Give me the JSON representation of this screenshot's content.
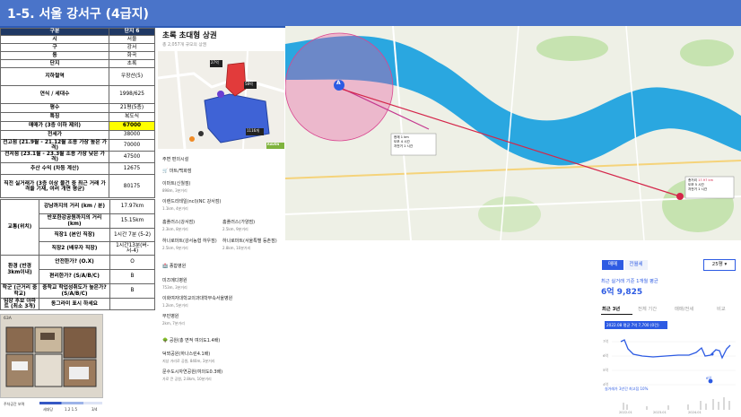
{
  "header": {
    "title": "1-5. 서울 강서구 (4급지)"
  },
  "spec_table": {
    "col_header": "구분",
    "col_value": "단지 6",
    "rows": [
      {
        "label": "시",
        "value": "서울"
      },
      {
        "label": "구",
        "value": "강서"
      },
      {
        "label": "동",
        "value": "화곡"
      },
      {
        "label": "단지",
        "value": "초록"
      },
      {
        "label": "지하철역",
        "value": "우장산(5)"
      },
      {
        "label": "연식 / 세대수",
        "value": "1998/625"
      },
      {
        "label": "평수",
        "value": "21평(5층)"
      },
      {
        "label": "특징",
        "value": "복도식"
      },
      {
        "label": "매매가 (3층 이하 제외)",
        "value": "67000"
      },
      {
        "label": "전세가",
        "value": "38000"
      },
      {
        "label": "전고점 (21.9월 - 21.12월 조용 가장 높은 가격)",
        "value": "70000"
      },
      {
        "label": "전저점 (23.1월 - 23.3월 조용 가장 낮은 가격)",
        "value": "47500"
      },
      {
        "label": "추산 수익 (차등 계산)",
        "value": "12675"
      },
      {
        "label": "직전 실거래가 (3층 이상 물건 중 최근 거래 가격을 기재, 여러 개면 평균)",
        "value": "80175"
      }
    ],
    "traffic_group": "교통(위치)",
    "traffic_rows": [
      {
        "label": "강남까지의 거리 (km / 분)",
        "value": "17.97km"
      },
      {
        "label": "반포한강공원까지의 거리 (km)",
        "value": "15.15km"
      },
      {
        "label": "직장1 (본인 직장)",
        "value": "1시간 7분 (5-2)"
      },
      {
        "label": "직장2 (배우자 직장)",
        "value": "1시간13분(버-서-4)"
      }
    ],
    "env_group": "환경 (반경 3km이내)",
    "env_rows": [
      {
        "label": "안전한가? (O.X)",
        "value": "O"
      },
      {
        "label": "편리한가? (S/A/B/C)",
        "value": "B"
      }
    ],
    "school_group": "학군 (근거리 중학교)",
    "school_rows": [
      {
        "label": "중학교 학업성취도가 높은가? (S/A/B/C)",
        "value": "B"
      }
    ],
    "after_group": "임장 후보 아파트 (최소 3개)",
    "after_rows": [
      {
        "label": "동그라미 표시 하세요",
        "value": ""
      }
    ]
  },
  "floorplan": {
    "badge": "63A",
    "legend_title": "주차공간 보력",
    "legend_items": [
      "세대당",
      "1.2 1.5",
      "3/4"
    ]
  },
  "panel": {
    "title": "초록 초대형 상권",
    "subtitle": "총 2,057개 규모의 상권",
    "section_title": "주변 편의시설",
    "market_head": "마트/백화점",
    "items": [
      {
        "name": "이마트(신월점)",
        "dist": "898m, 3분거리"
      },
      {
        "name": "이랜드리테일(ncl)(NC 강서점)",
        "dist": "1.1km, 4분거리"
      },
      {
        "name": "홈플러스(강서점)",
        "dist": "2.3km, 8분거리"
      },
      {
        "name": "홈플러스(가양점)",
        "dist": "2.5km, 9분거리"
      },
      {
        "name": "하나로마트(강서농협 하우점)",
        "dist": "2.5km, 9분거리"
      },
      {
        "name": "하나로마트(서울특별 등촌점)",
        "dist": "2.8km, 10분거리"
      }
    ],
    "hospital_head": "종합병원",
    "hospitals": [
      {
        "name": "미즈메디병원",
        "dist": "753m, 3분거리"
      },
      {
        "name": "이화여자대학교의과대학부속서울병원",
        "dist": "1.2km, 5분거리"
      },
      {
        "name": "부민병원",
        "dist": "2km, 7분거리"
      }
    ],
    "park_head": "공원(총 면적 여의도1.4배)",
    "parks": [
      {
        "name": "덕뫼공원(하나스린4.1배)",
        "dist": "지상 거리로 공원, 840m, 3분거리"
      },
      {
        "name": "문수도시자연공원(여의도0.3배)",
        "dist": "가로 큰 공원, 2.8km, 10분거리"
      }
    ]
  },
  "map_left": {
    "pin1_label": "58억",
    "pin2_label": "27억",
    "pin3_label": "1116개",
    "brand_label": "RAVEN"
  },
  "map_big": {
    "info_box_left": [
      [
        "현재",
        "1 km"
      ],
      [
        "도보",
        "4 시간"
      ],
      [
        "자전거",
        "1 시간"
      ]
    ],
    "info_box_right": [
      [
        "총거리",
        "17.97 km"
      ],
      [
        "도보",
        "5 시간"
      ],
      [
        "자전거",
        "1 시간"
      ]
    ],
    "marker_a": "A"
  },
  "widget": {
    "btn_sale": "매매",
    "btn_jeonse": "전월세",
    "select_value": "25평",
    "caption": "최근 실거래 기준 1개월 평균",
    "price": "6억 9,825",
    "tabs": [
      "최근 3년",
      "전체 기간",
      "매매/전세",
      "비교"
    ],
    "tooltip": "2022.08 평균 7억 7,700 (0건)",
    "y_labels": [
      "7억",
      "6억",
      "5억",
      "4억"
    ],
    "point_label": "6억",
    "bottom_note": "실거래가 3년간 최고점 10%",
    "x_labels": [
      "2022.01",
      "2023.01",
      "2024.01"
    ],
    "colors": {
      "accent": "#2d5be3",
      "select_border": "#2d5be3",
      "sale_btn": "#2d5be3"
    }
  }
}
